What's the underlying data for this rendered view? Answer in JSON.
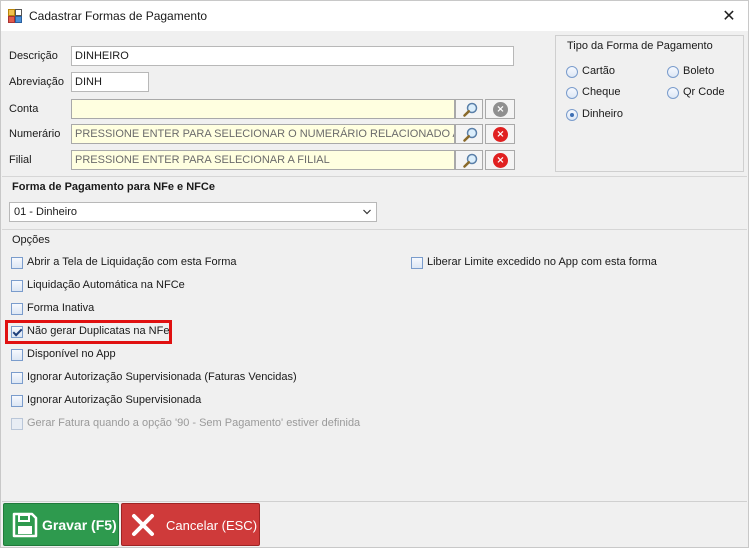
{
  "window": {
    "title": "Cadastrar Formas de Pagamento"
  },
  "form": {
    "descricao": {
      "label": "Descrição",
      "value": "DINHEIRO"
    },
    "abreviacao": {
      "label": "Abreviação",
      "value": "DINH"
    },
    "conta": {
      "label": "Conta",
      "value": ""
    },
    "numerario": {
      "label": "Numerário",
      "placeholder": "PRESSIONE ENTER PARA SELECIONAR O NUMERÁRIO RELACIONADO A E"
    },
    "filial": {
      "label": "Filial",
      "placeholder": "PRESSIONE ENTER PARA SELECIONAR A FILIAL"
    }
  },
  "tipo": {
    "title": "Tipo da Forma de Pagamento",
    "options": [
      {
        "label": "Cartão",
        "selected": false
      },
      {
        "label": "Boleto",
        "selected": false
      },
      {
        "label": "Cheque",
        "selected": false
      },
      {
        "label": "Qr Code",
        "selected": false
      },
      {
        "label": "Dinheiro",
        "selected": true
      }
    ]
  },
  "nfe": {
    "title": "Forma de Pagamento para NFe e NFCe",
    "selected": "01 - Dinheiro"
  },
  "opcoes": {
    "title": "Opções",
    "items": [
      {
        "label": "Abrir a Tela de Liquidação com esta Forma",
        "checked": false,
        "enabled": true
      },
      {
        "label": "Liquidação Automática na NFCe",
        "checked": false,
        "enabled": true
      },
      {
        "label": "Forma Inativa",
        "checked": false,
        "enabled": true
      },
      {
        "label": "Não gerar Duplicatas na NFe",
        "checked": true,
        "enabled": true
      },
      {
        "label": "Disponível no App",
        "checked": false,
        "enabled": true
      },
      {
        "label": "Ignorar Autorização Supervisionada (Faturas Vencidas)",
        "checked": false,
        "enabled": true
      },
      {
        "label": "Ignorar Autorização Supervisionada",
        "checked": false,
        "enabled": true
      },
      {
        "label": "Gerar Fatura quando a opção '90 - Sem Pagamento' estiver definida",
        "checked": false,
        "enabled": false
      },
      {
        "label": "Liberar Limite excedido no App com esta forma",
        "checked": false,
        "enabled": true
      }
    ]
  },
  "buttons": {
    "save": "Gravar (F5)",
    "cancel": "Cancelar (ESC)"
  },
  "colors": {
    "save_bg": "#2e9a4e",
    "cancel_bg": "#cf3a3a",
    "highlight": "#e01010",
    "field_yellow": "#ffffe0"
  },
  "icons": {
    "app": "form-window-icon",
    "close": "close-icon",
    "search": "search-icon",
    "clear": "clear-icon",
    "save": "save-icon",
    "cancel": "cancel-icon"
  }
}
